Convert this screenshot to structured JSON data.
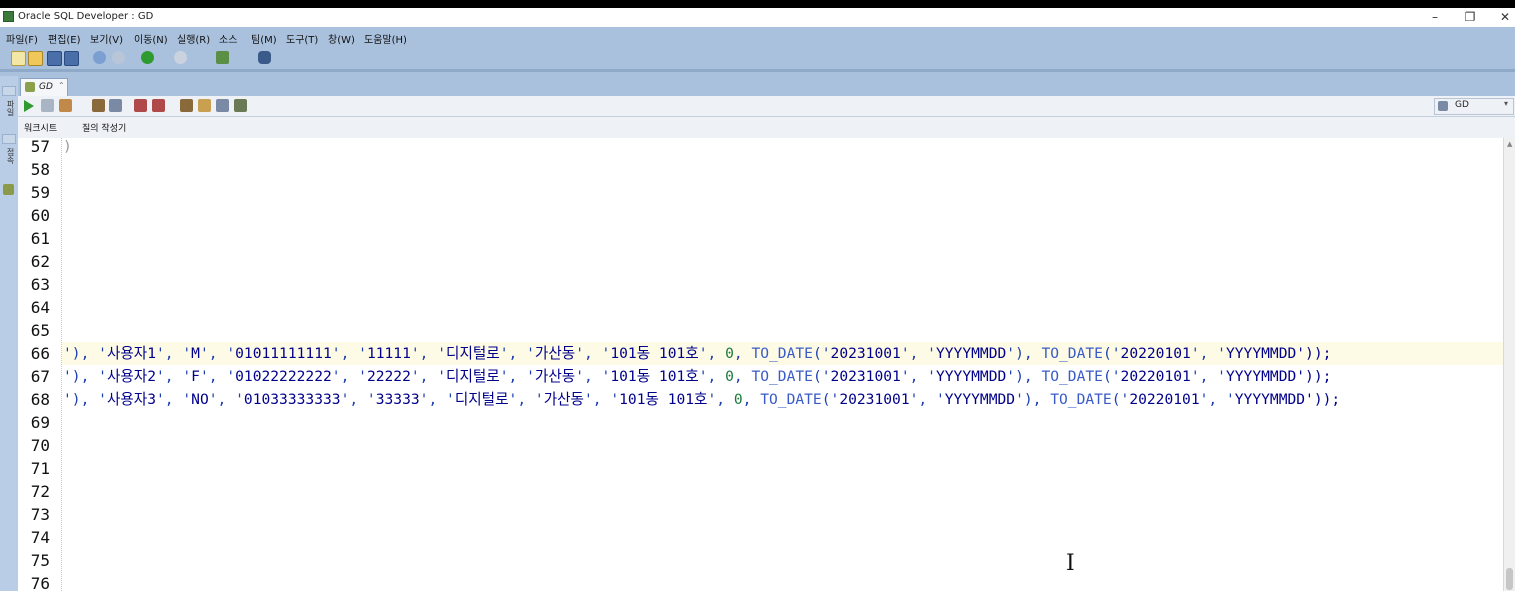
{
  "window": {
    "title": "Oracle SQL Developer : GD"
  },
  "menu": [
    "파일(F)",
    "편집(E)",
    "보기(V)",
    "이동(N)",
    "실행(R)",
    "소스",
    "팀(M)",
    "도구(T)",
    "창(W)",
    "도움말(H)"
  ],
  "doc_tab": {
    "label": "GD"
  },
  "connection": {
    "label": "GD"
  },
  "subtabs": [
    "워크시트",
    "질의 작성기"
  ],
  "left_strip_labels": [
    "파일",
    "접속",
    "보고서"
  ],
  "colors": {
    "chrome": "#a9c1dd",
    "string": "#1c3fb0",
    "number": "#1a7a3a",
    "highlight": "#fdfbe6"
  },
  "editor": {
    "line_numbers": [
      "57",
      "58",
      "59",
      "60",
      "61",
      "62",
      "63",
      "64",
      "65",
      "66",
      "67",
      "68",
      "69",
      "70",
      "71",
      "72",
      "73",
      "74",
      "75",
      "76"
    ],
    "lines": [
      {
        "line": "57",
        "code": ")"
      },
      {
        "line": "66",
        "code": "'), '사용자1', 'M', '01011111111', '11111', '디지털로', '가산동', '101동 101호', 0, TO_DATE('20231001', 'YYYYMMDD'), TO_DATE('20220101', 'YYYYMMDD'));"
      },
      {
        "line": "67",
        "code": "'), '사용자2', 'F', '01022222222', '22222', '디지털로', '가산동', '101동 101호', 0, TO_DATE('20231001', 'YYYYMMDD'), TO_DATE('20220101', 'YYYYMMDD'));"
      },
      {
        "line": "68",
        "code": "'), '사용자3', 'NO', '01033333333', '33333', '디지털로', '가산동', '101동 101호', 0, TO_DATE('20231001', 'YYYYMMDD'), TO_DATE('20220101', 'YYYYMMDD'));"
      }
    ]
  }
}
